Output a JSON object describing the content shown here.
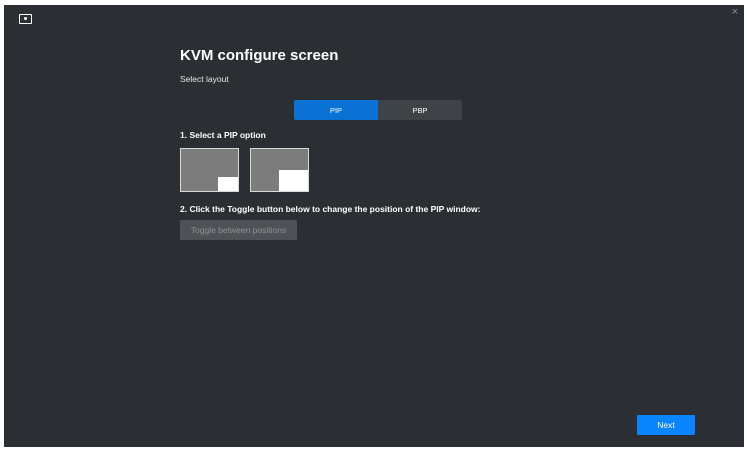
{
  "window": {
    "app_icon": "monitor-icon",
    "close_icon": "close-icon",
    "close_glyph": "×"
  },
  "header": {
    "title": "KVM configure screen",
    "subtitle": "Select layout"
  },
  "layout_selector": {
    "options": [
      {
        "label": "PIP",
        "selected": true
      },
      {
        "label": "PBP",
        "selected": false
      }
    ]
  },
  "step1": {
    "label": "1. Select a PIP option",
    "options": [
      "pip-small-bottom-right",
      "pip-large-bottom-right"
    ]
  },
  "step2": {
    "label": "2. Click the Toggle button below to change the position of the PIP window:",
    "toggle_label": "Toggle between positions",
    "toggle_enabled": false
  },
  "footer": {
    "next_label": "Next"
  },
  "colors": {
    "background": "#2b2f33",
    "accent": "#0a84ff",
    "segment_active": "#0a72d4"
  }
}
